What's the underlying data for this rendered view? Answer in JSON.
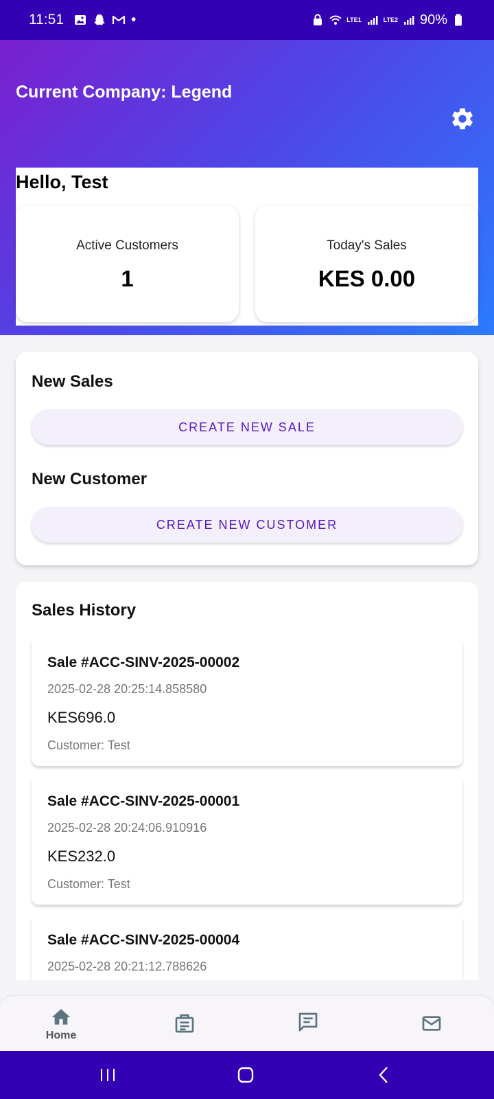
{
  "status_bar": {
    "time": "11:51",
    "dot": "•",
    "network_1": "LTE1",
    "network_2": "LTE2",
    "battery": "90%"
  },
  "header": {
    "company_title": "Current Company: Legend",
    "greeting": "Hello, Test",
    "stats": [
      {
        "label": "Active Customers",
        "value": "1"
      },
      {
        "label": "Today's Sales",
        "value": "KES 0.00"
      }
    ]
  },
  "actions": {
    "new_sales_title": "New Sales",
    "create_sale_label": "CREATE NEW SALE",
    "new_customer_title": "New Customer",
    "create_customer_label": "CREATE NEW CUSTOMER"
  },
  "history": {
    "title": "Sales History",
    "items": [
      {
        "id": "Sale #ACC-SINV-2025-00002",
        "date": "2025-02-28 20:25:14.858580",
        "amount": "KES696.0",
        "customer": "Customer: Test"
      },
      {
        "id": "Sale #ACC-SINV-2025-00001",
        "date": "2025-02-28 20:24:06.910916",
        "amount": "KES232.0",
        "customer": "Customer: Test"
      },
      {
        "id": "Sale #ACC-SINV-2025-00004",
        "date": "2025-02-28 20:21:12.788626",
        "amount": "",
        "customer": ""
      }
    ]
  },
  "bottom_nav": {
    "home_label": "Home",
    "icons": [
      "home-icon",
      "receipt-icon",
      "chat-icon",
      "mail-icon"
    ]
  },
  "colors": {
    "status_bar": "#3300b3",
    "accent": "#5a18b8",
    "button_bg": "#f3effb",
    "nav_icon": "#5d7480"
  }
}
